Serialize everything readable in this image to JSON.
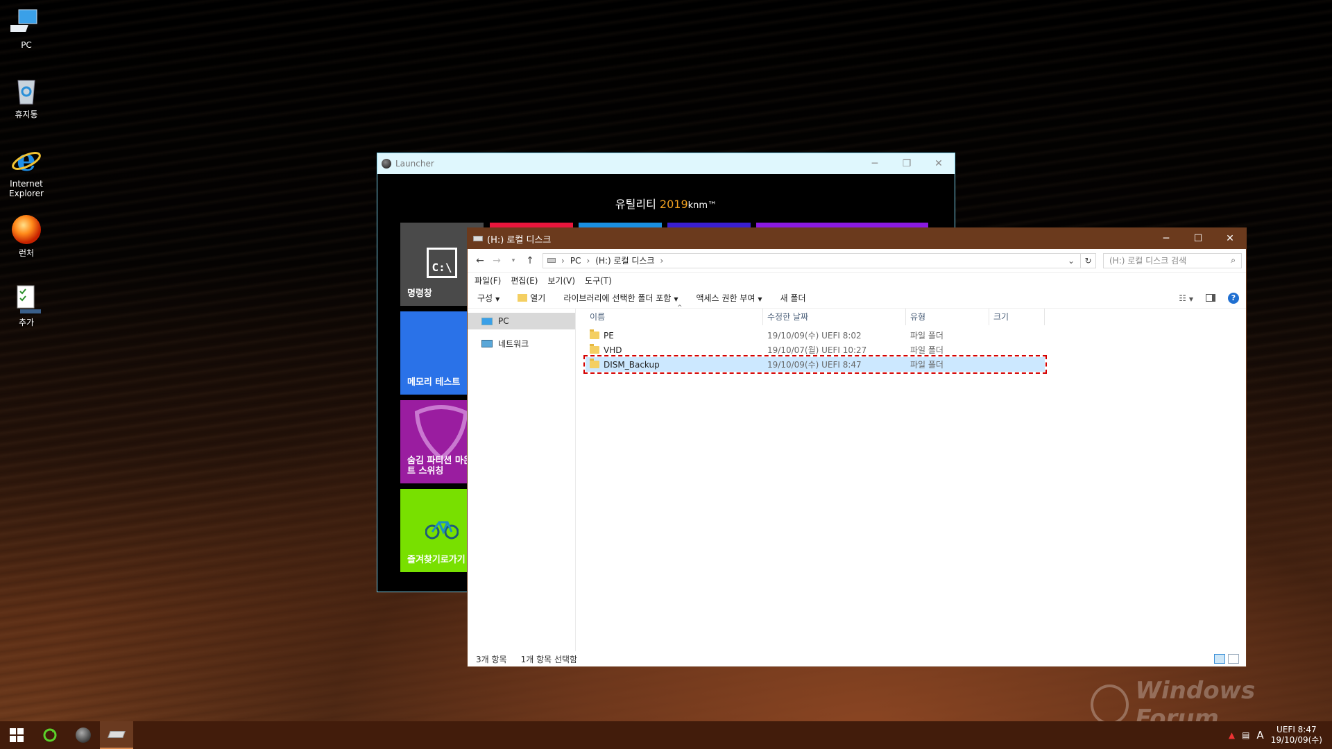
{
  "desktop": {
    "icons": [
      {
        "label": "PC",
        "icon": "computer-icon"
      },
      {
        "label": "휴지통",
        "icon": "recycle-bin-icon"
      },
      {
        "label": "Internet Explorer",
        "icon": "internet-explorer-icon"
      },
      {
        "label": "런처",
        "icon": "launcher-orb-icon"
      },
      {
        "label": "추가",
        "icon": "checklist-icon"
      }
    ]
  },
  "launcher": {
    "title": "Launcher",
    "heading_prefix": "유틸리티",
    "heading_year": "2019",
    "heading_suffix": "knm™",
    "tiles": [
      {
        "label": "명령창",
        "color": "#4a4a4a",
        "icon": "command-prompt-icon"
      },
      {
        "label": "메모리 테스트",
        "color": "#2a72e8"
      },
      {
        "label": "숨김 파티션 마운트 스위칭",
        "color": "#9a1da0",
        "icon": "guitar-pick-icon"
      },
      {
        "label": "즐겨찾기로가기",
        "color": "#78e000",
        "icon": "bicycle-icon"
      }
    ],
    "top_strip_colors": [
      "#e8163c",
      "#1a8fe0",
      "#3a1fd0",
      "#8a1ae0"
    ]
  },
  "explorer": {
    "title": "(H:) 로컬 디스크",
    "breadcrumb": [
      "PC",
      "(H:) 로컬 디스크"
    ],
    "search_placeholder": "(H:) 로컬 디스크 검색",
    "menu": [
      "파일(F)",
      "편집(E)",
      "보기(V)",
      "도구(T)"
    ],
    "commands": {
      "organize": "구성",
      "open": "열기",
      "include_in_library": "라이브러리에 선택한 폴더 포함",
      "share_with": "액세스 권한 부여",
      "new_folder": "새 폴더"
    },
    "nav": [
      {
        "label": "PC",
        "icon": "computer-icon",
        "selected": true
      },
      {
        "label": "네트워크",
        "icon": "network-icon",
        "selected": false
      }
    ],
    "columns": [
      "이름",
      "수정한 날짜",
      "유형",
      "크기"
    ],
    "files": [
      {
        "name": "PE",
        "modified": "19/10/09(수) UEFI  8:02",
        "type": "파일 폴더",
        "size": ""
      },
      {
        "name": "VHD",
        "modified": "19/10/07(월) UEFI  10:27",
        "type": "파일 폴더",
        "size": ""
      },
      {
        "name": "DISM_Backup",
        "modified": "19/10/09(수) UEFI  8:47",
        "type": "파일 폴더",
        "size": ""
      }
    ],
    "status_items": "3개 항목",
    "status_selected": "1개 항목 선택함"
  },
  "watermark": "Windows Forum",
  "taskbar": {
    "ime": "A",
    "time": "UEFI  8:47",
    "date": "19/10/09(수)"
  }
}
